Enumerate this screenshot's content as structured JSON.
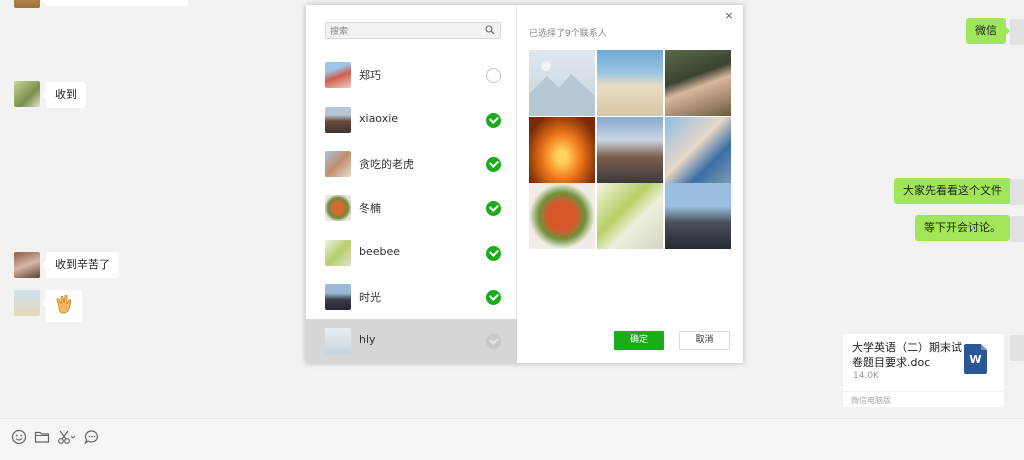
{
  "chat": {
    "messages": [
      {
        "text": "收到"
      },
      {
        "text": "微信"
      },
      {
        "text": "大家先看看这个文件"
      },
      {
        "text": "等下开会讨论。"
      },
      {
        "text": "收到辛苦了"
      }
    ],
    "file": {
      "name": "大学英语（二）期末试卷题目要求.doc",
      "size": "14.0K",
      "source": "微信电脑版",
      "icon_letter": "W"
    }
  },
  "modal": {
    "search_placeholder": "搜索",
    "selected_title": "已选择了9个联系人",
    "close_glyph": "×",
    "contacts": [
      {
        "name": "郑巧",
        "checked": false
      },
      {
        "name": "xiaoxie",
        "checked": true
      },
      {
        "name": "贪吃的老虎",
        "checked": true
      },
      {
        "name": "冬楠",
        "checked": true
      },
      {
        "name": "beebee",
        "checked": true
      },
      {
        "name": "时光",
        "checked": true
      },
      {
        "name": "hly",
        "checked": true
      }
    ],
    "confirm_label": "确定",
    "cancel_label": "取消"
  },
  "toolbar": {
    "icons": [
      "emoji-icon",
      "folder-icon",
      "scissors-icon",
      "chat-history-icon"
    ]
  },
  "colors": {
    "accent": "#1aad19",
    "my_bubble": "#9fe658"
  }
}
